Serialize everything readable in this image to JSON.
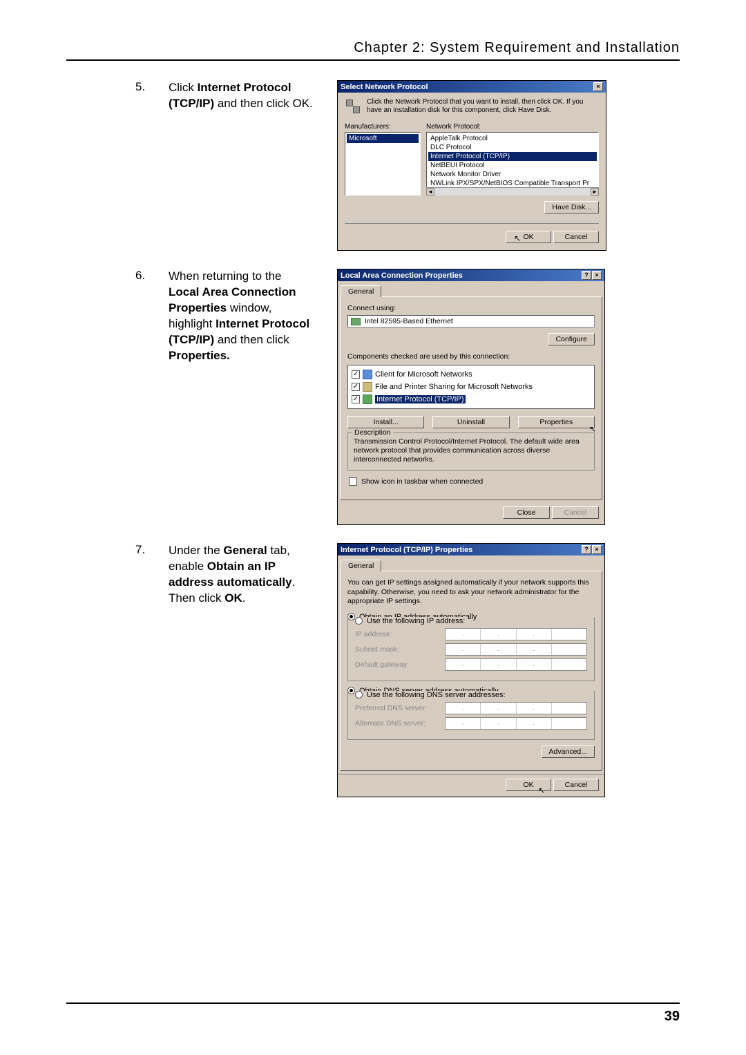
{
  "header": {
    "chapter": "Chapter 2: System Requirement and Installation"
  },
  "page_number": "39",
  "steps": [
    {
      "num": "5.",
      "text_pre": "Click ",
      "text_bold": "Internet Protocol (TCP/IP)",
      "text_post": " and then click OK."
    },
    {
      "num": "6.",
      "text_pre": "When returning to the ",
      "text_bold": "Local Area Connection Properties",
      "text_mid": " window, highlight ",
      "text_bold2": "Internet Protocol (TCP/IP)",
      "text_mid2": " and then click ",
      "text_bold3": "Properties.",
      "text_post": ""
    },
    {
      "num": "7.",
      "text_pre": "Under the ",
      "text_bold": "General",
      "text_mid": " tab, enable ",
      "text_bold2": "Obtain an IP address automatically",
      "text_mid2": ". Then click ",
      "text_bold3": "OK",
      "text_post": "."
    }
  ],
  "dlg1": {
    "title": "Select Network Protocol",
    "hint": "Click the Network Protocol that you want to install, then click OK. If you have an installation disk for this component, click Have Disk.",
    "manufacturers_label": "Manufacturers:",
    "manufacturers": [
      "Microsoft"
    ],
    "protocol_label": "Network Protocol:",
    "protocols": [
      "AppleTalk Protocol",
      "DLC Protocol",
      "Internet Protocol (TCP/IP)",
      "NetBEUI Protocol",
      "Network Monitor Driver",
      "NWLink IPX/SPX/NetBIOS Compatible Transport Pr"
    ],
    "selected_protocol_index": 2,
    "have_disk": "Have Disk...",
    "ok": "OK",
    "cancel": "Cancel"
  },
  "dlg2": {
    "title": "Local Area Connection Properties",
    "tab": "General",
    "connect_using_label": "Connect using:",
    "adapter": "Intel 82595-Based Ethernet",
    "configure": "Configure",
    "components_label": "Components checked are used by this connection:",
    "components": [
      {
        "label": "Client for Microsoft Networks",
        "icon": "client"
      },
      {
        "label": "File and Printer Sharing for Microsoft Networks",
        "icon": "srv"
      },
      {
        "label": "Internet Protocol (TCP/IP)",
        "icon": "proto",
        "selected": true
      }
    ],
    "install": "Install...",
    "uninstall": "Uninstall",
    "properties": "Properties",
    "description_label": "Description",
    "description": "Transmission Control Protocol/Internet Protocol. The default wide area network protocol that provides communication across diverse interconnected networks.",
    "show_icon": "Show icon in taskbar when connected",
    "close": "Close",
    "cancel": "Cancel"
  },
  "dlg3": {
    "title": "Internet Protocol (TCP/IP) Properties",
    "tab": "General",
    "info": "You can get IP settings assigned automatically if your network supports this capability. Otherwise, you need to ask your network administrator for the appropriate IP settings.",
    "obtain_ip": "Obtain an IP address automatically",
    "use_ip": "Use the following IP address:",
    "ip_address": "IP address:",
    "subnet": "Subnet mask:",
    "gateway": "Default gateway:",
    "obtain_dns": "Obtain DNS server address automatically",
    "use_dns": "Use the following DNS server addresses:",
    "pref_dns": "Preferred DNS server:",
    "alt_dns": "Alternate DNS server:",
    "advanced": "Advanced...",
    "ok": "OK",
    "cancel": "Cancel"
  }
}
